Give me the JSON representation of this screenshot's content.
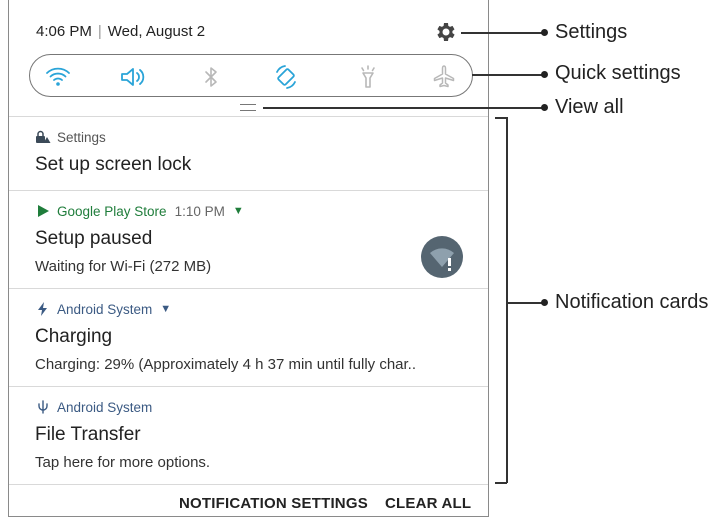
{
  "status": {
    "time": "4:06 PM",
    "date": "Wed, August 2"
  },
  "callouts": {
    "settings": "Settings",
    "quick_settings": "Quick settings",
    "view_all": "View all",
    "notification_cards": "Notification cards"
  },
  "quick_settings": {
    "icons": [
      "wifi-icon",
      "sound-icon",
      "bluetooth-icon",
      "auto-rotate-icon",
      "flashlight-icon",
      "airplane-mode-icon"
    ],
    "accent": "#2aa4d8",
    "inactive": "#b8b8b8"
  },
  "notifications": [
    {
      "app": "Settings",
      "title": "Set up screen lock",
      "sub": ""
    },
    {
      "app": "Google Play Store",
      "time": "1:10 PM",
      "title": "Setup paused",
      "sub": "Waiting for Wi-Fi (272 MB)"
    },
    {
      "app": "Android System",
      "title": "Charging",
      "sub": "Charging: 29% (Approximately 4 h 37 min until fully char.."
    },
    {
      "app": "Android System",
      "title": "File Transfer",
      "sub": "Tap here for more options."
    }
  ],
  "footer": {
    "notification_settings": "NOTIFICATION SETTINGS",
    "clear_all": "CLEAR ALL"
  },
  "colors": {
    "play_green": "#1f7d3b",
    "system_blue": "#3b5a83"
  }
}
